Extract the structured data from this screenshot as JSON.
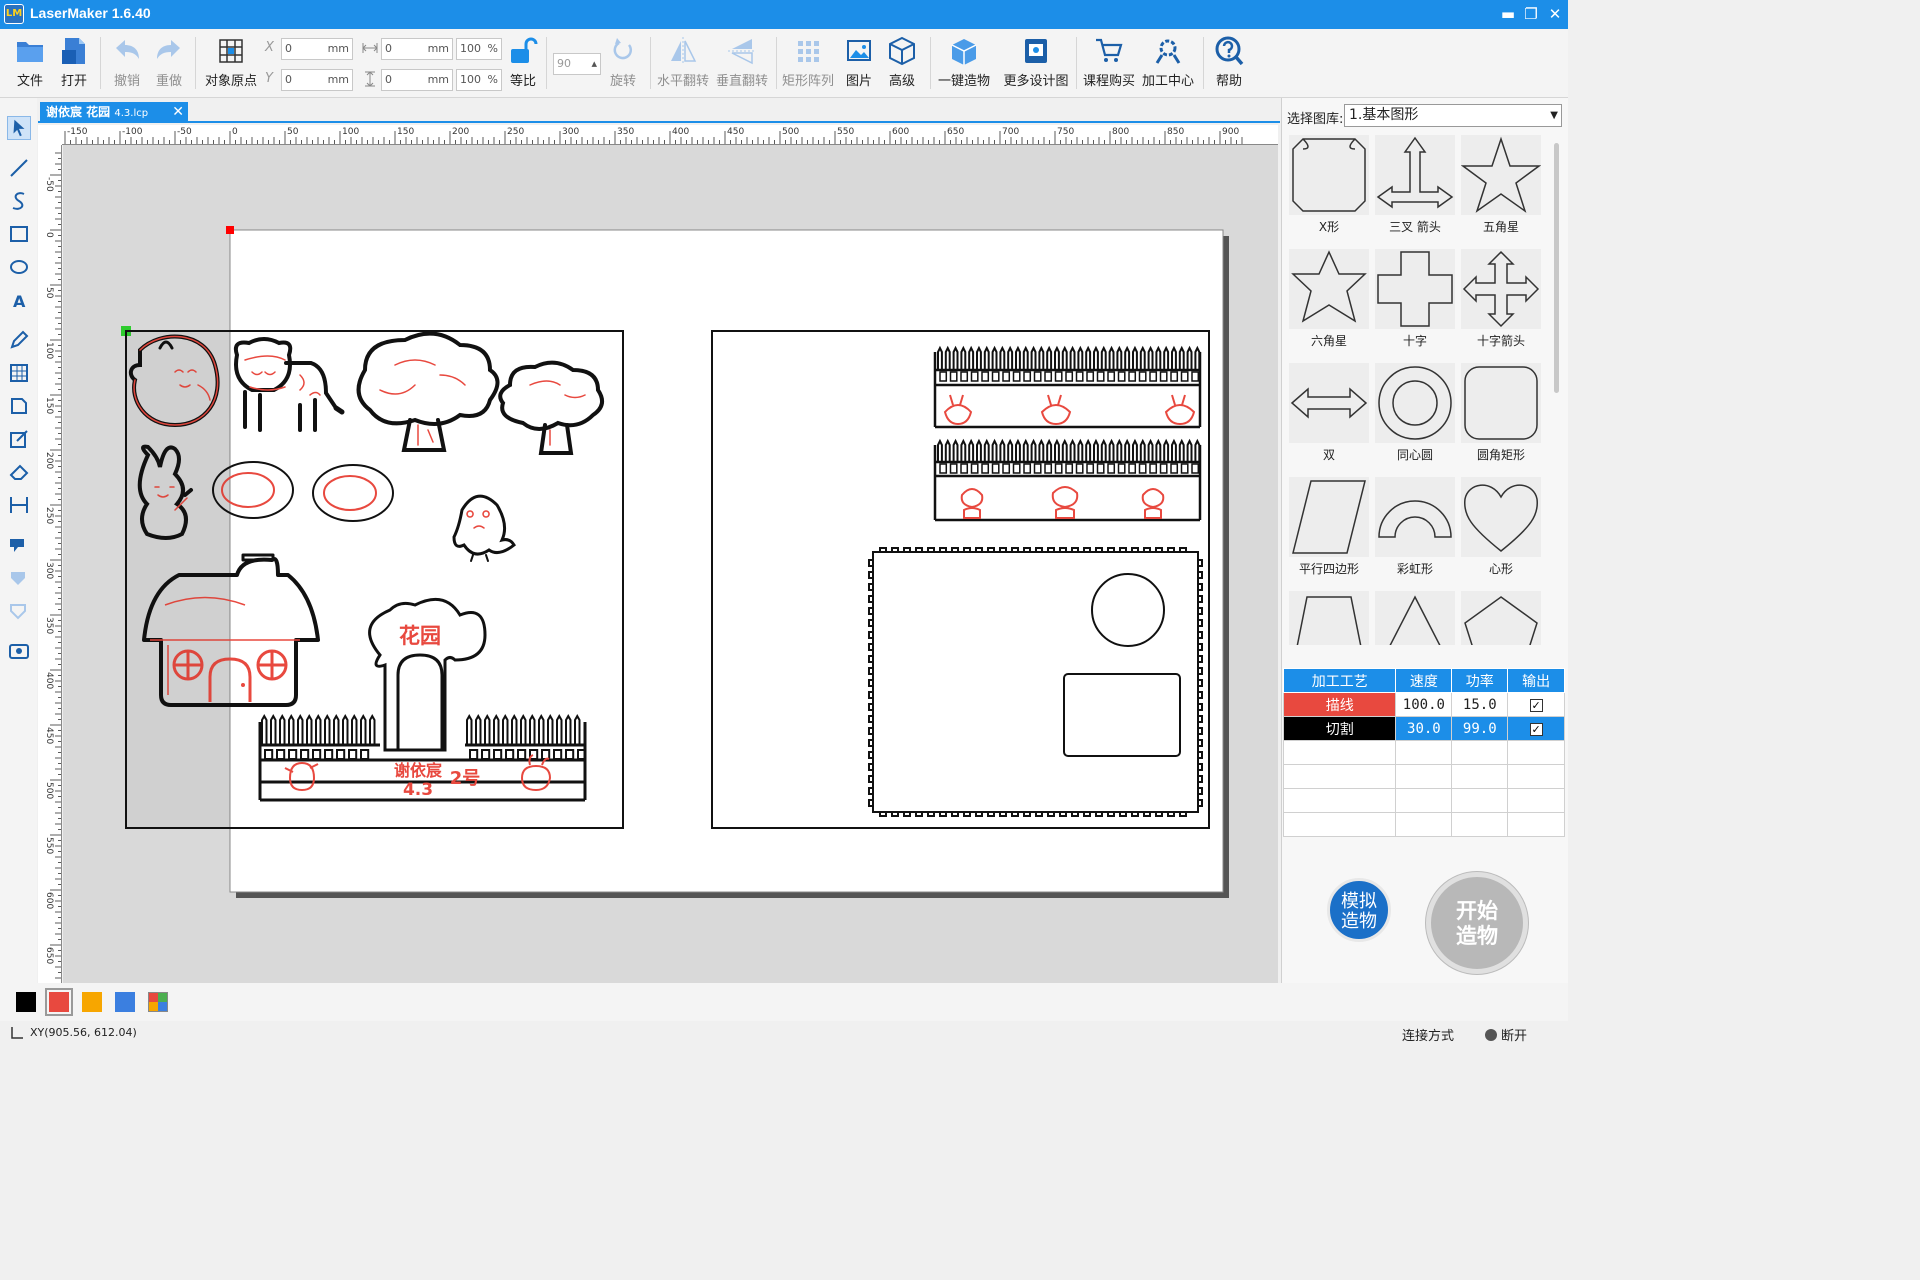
{
  "app": {
    "title": "LaserMaker 1.6.40",
    "logo_text": "LM"
  },
  "window": {
    "minimize": "▬",
    "restore": "❐",
    "close": "✕"
  },
  "toolbar": {
    "file": "文件",
    "open": "打开",
    "undo": "撤销",
    "redo": "重做",
    "origin": "对象原点",
    "x_label": "X",
    "y_label": "Y",
    "x_value": "0",
    "y_value": "0",
    "unit": "mm",
    "w_value": "0",
    "h_value": "0",
    "w_percent": "100",
    "h_percent": "100",
    "percent": "%",
    "ratio": "等比",
    "rotate_value": "90",
    "rotate": "旋转",
    "hflip": "水平翻转",
    "vflip": "垂直翻转",
    "array": "矩形阵列",
    "image": "图片",
    "advanced": "高级",
    "one_click": "一键造物",
    "more_designs": "更多设计图",
    "buy_course": "课程购买",
    "center": "加工中心",
    "help": "帮助"
  },
  "document": {
    "tab_title": "谢依宸 花园",
    "tab_sub": "4.3.lcp",
    "close": "✕"
  },
  "ruler": {
    "h_ticks": [
      "-150",
      "-100",
      "-50",
      "0",
      "50",
      "100",
      "150",
      "200",
      "250",
      "300",
      "350",
      "400",
      "450",
      "500",
      "550",
      "600",
      "650",
      "700",
      "750",
      "800",
      "850",
      "900"
    ],
    "v_ticks": [
      "-50",
      "0",
      "50",
      "100",
      "150",
      "200",
      "250",
      "300",
      "350",
      "400",
      "450",
      "500",
      "550",
      "600",
      "650"
    ]
  },
  "artwork": {
    "garden_text": "花园",
    "name_text": "谢依宸",
    "number_text": "2号",
    "date_text": "4.3"
  },
  "library": {
    "label": "选择图库:",
    "selected": "1.基本图形",
    "shapes": [
      "X形",
      "三叉 箭头",
      "五角星",
      "六角星",
      "十字",
      "十字箭头",
      "双",
      "同心圆",
      "圆角矩形",
      "平行四边形",
      "彩虹形",
      "心形",
      "",
      "",
      ""
    ]
  },
  "layers": {
    "headers": [
      "加工工艺",
      "速度",
      "功率",
      "输出"
    ],
    "rows": [
      {
        "name": "描线",
        "speed": "100.0",
        "power": "15.0",
        "output": true,
        "color": "#e8493f"
      },
      {
        "name": "切割",
        "speed": "30.0",
        "power": "99.0",
        "output": true,
        "color": "#000000"
      }
    ]
  },
  "actions": {
    "simulate": "模拟造物",
    "start": "开始造物"
  },
  "palette": [
    "#000000",
    "#e8493f",
    "#f7a600",
    "#3b7fe0",
    "multi"
  ],
  "status": {
    "xy": "XY(905.56, 612.04)",
    "connection_label": "连接方式",
    "connection_state": "断开"
  }
}
